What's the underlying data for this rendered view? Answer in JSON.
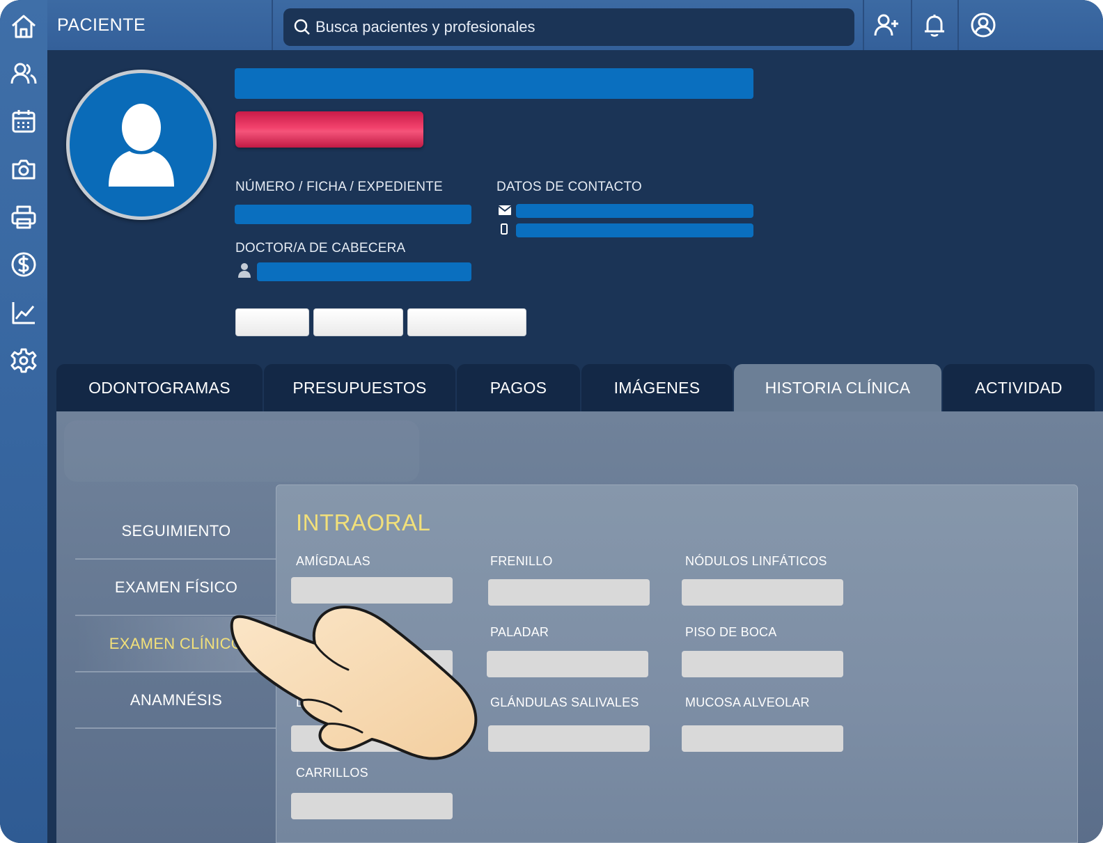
{
  "header": {
    "title": "PACIENTE",
    "search_placeholder": "Busca pacientes y profesionales"
  },
  "sidebar": {
    "icons": [
      "home-icon",
      "users-icon",
      "calendar-icon",
      "camera-icon",
      "printer-icon",
      "dollar-icon",
      "chart-icon",
      "gear-icon"
    ]
  },
  "topbar_icons": [
    "add-user-icon",
    "bell-icon",
    "account-icon"
  ],
  "profile": {
    "record_label": "NÚMERO / FICHA / EXPEDIENTE",
    "contact_label": "DATOS DE CONTACTO",
    "doctor_label": "DOCTOR/A DE CABECERA"
  },
  "tabs": [
    {
      "label": "ODONTOGRAMAS"
    },
    {
      "label": "PRESUPUESTOS"
    },
    {
      "label": "PAGOS"
    },
    {
      "label": "IMÁGENES"
    },
    {
      "label": "HISTORIA CLÍNICA",
      "active": true
    },
    {
      "label": "ACTIVIDAD"
    }
  ],
  "side_menu": [
    {
      "label": "SEGUIMIENTO"
    },
    {
      "label": "EXAMEN FÍSICO"
    },
    {
      "label": "EXAMEN CLÍNICO",
      "active": true
    },
    {
      "label": "ANAMNÉSIS"
    }
  ],
  "exam": {
    "title": "INTRAORAL",
    "fields": {
      "amigdalas": "AMÍGDALAS",
      "frenillo": "FRENILLO",
      "nodulos": "NÓDULOS LINFÁTICOS",
      "paladar": "PALADAR",
      "piso_boca": "PISO DE BOCA",
      "lengua": "LENG",
      "glandulas": "GLÁNDULAS SALIVALES",
      "mucosa": "MUCOSA ALVEOLAR",
      "carrillos": "CARRILLOS"
    }
  },
  "colors": {
    "accent_yellow": "#f2e07a",
    "bar_blue": "#0a6fbf",
    "tag_red": "#f2426c",
    "nav_dark": "#132846"
  }
}
